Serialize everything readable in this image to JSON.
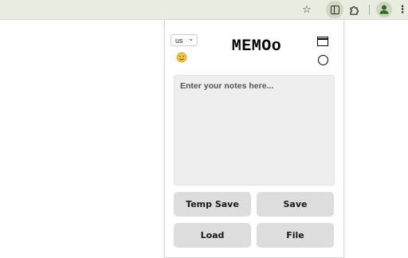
{
  "toolbar": {
    "star_icon": "star-icon",
    "side_panel_icon": "side-panel-icon",
    "extensions_icon": "puzzle-icon",
    "profile_icon": "profile-icon",
    "menu_icon": "kebab-menu-icon"
  },
  "popup": {
    "language": {
      "selected": "us"
    },
    "title": "MEMOo",
    "notes": {
      "placeholder": "Enter your notes here...",
      "value": ""
    },
    "buttons": {
      "temp_save": "Temp Save",
      "save": "Save",
      "load": "Load",
      "file": "File"
    },
    "colors": {
      "button_bg": "#dddddd",
      "notes_bg": "#eeeeee",
      "toolbar_bg": "#e9eddf"
    }
  }
}
